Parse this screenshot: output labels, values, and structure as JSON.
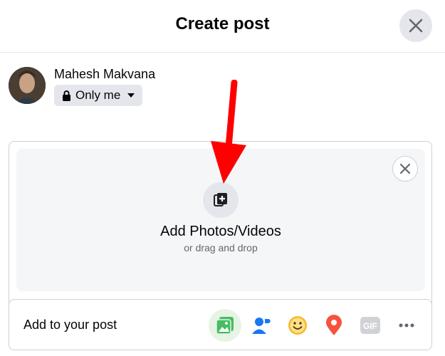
{
  "header": {
    "title": "Create post",
    "close_icon": "close-icon"
  },
  "user": {
    "name": "Mahesh Makvana",
    "privacy": "Only me",
    "privacy_icon": "lock-icon",
    "privacy_caret": "caret-down-icon"
  },
  "media": {
    "title": "Add Photos/Videos",
    "subtitle": "or drag and drop",
    "icon": "add-photo-icon",
    "close_icon": "close-icon"
  },
  "toolbar": {
    "label": "Add to your post",
    "items": [
      {
        "name": "photo-video",
        "icon": "photo-icon",
        "color": "#45bd62"
      },
      {
        "name": "tag-people",
        "icon": "tag-people-icon",
        "color": "#1877f2"
      },
      {
        "name": "feeling-activity",
        "icon": "smiley-icon",
        "color": "#f7b928"
      },
      {
        "name": "check-in",
        "icon": "location-pin-icon",
        "color": "#f5533d"
      },
      {
        "name": "gif",
        "icon": "gif-icon",
        "color": "#d0d2d6"
      },
      {
        "name": "more",
        "icon": "more-icon",
        "color": "#606770"
      }
    ]
  },
  "colors": {
    "accent": "#1877f2",
    "annotation_arrow": "#ff0000"
  }
}
